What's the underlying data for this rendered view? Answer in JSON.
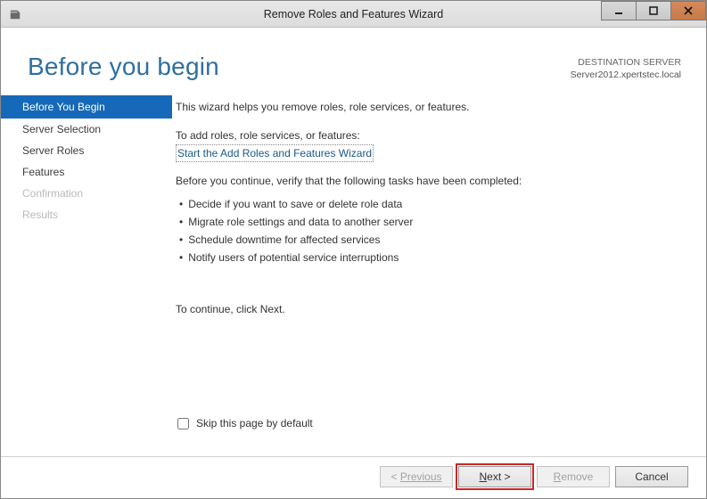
{
  "window": {
    "title": "Remove Roles and Features Wizard"
  },
  "heading": "Before you begin",
  "destination": {
    "label": "DESTINATION SERVER",
    "name": "Server2012.xpertstec.local"
  },
  "sidebar": {
    "items": [
      {
        "label": "Before You Begin",
        "state": "selected"
      },
      {
        "label": "Server Selection",
        "state": "normal"
      },
      {
        "label": "Server Roles",
        "state": "normal"
      },
      {
        "label": "Features",
        "state": "normal"
      },
      {
        "label": "Confirmation",
        "state": "disabled"
      },
      {
        "label": "Results",
        "state": "disabled"
      }
    ]
  },
  "content": {
    "intro": "This wizard helps you remove roles, role services, or features.",
    "add_label": "To add roles, role services, or features:",
    "add_link": "Start the Add Roles and Features Wizard",
    "verify": "Before you continue, verify that the following tasks have been completed:",
    "bullets": [
      "Decide if you want to save or delete role data",
      "Migrate role settings and data to another server",
      "Schedule downtime for affected services",
      "Notify users of potential service interruptions"
    ],
    "continue": "To continue, click Next.",
    "skip_label": "Skip this page by default"
  },
  "footer": {
    "previous": "Previous",
    "next": "Next >",
    "remove": "Remove",
    "cancel": "Cancel"
  }
}
